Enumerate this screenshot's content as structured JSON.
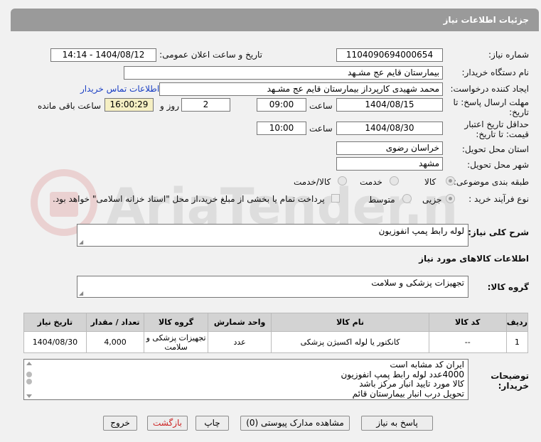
{
  "header": {
    "title": "جزئیات اطلاعات نیاز"
  },
  "form": {
    "need_number_label": "شماره نیاز:",
    "need_number": "1104090694000654",
    "announce_label": "تاریخ و ساعت اعلان عمومی:",
    "announce_value": "1404/08/12 - 14:14",
    "buyer_org_label": "نام دستگاه خریدار:",
    "buyer_org": "بیمارستان قایم  عج  مشـهد",
    "requester_label": "ایجاد کننده درخواست:",
    "requester": "محمد شهیدی کارپرداز بیمارستان قایم  عج  مشـهد",
    "contact_link": "اطلاعات تماس خریدار",
    "deadline_label_1": "مهلت ارسال پاسخ: تا",
    "deadline_label_2": "تاریخ:",
    "deadline_date": "1404/08/15",
    "time_label": "ساعت",
    "deadline_time": "09:00",
    "days_value": "2",
    "days_label": "روز و",
    "remaining_time": "16:00:29",
    "remaining_label": "ساعت باقی مانده",
    "validity_label_1": "حداقل تاریخ اعتبار",
    "validity_label_2": "قیمت: تا تاریخ:",
    "validity_date": "1404/08/30",
    "validity_time": "10:00",
    "province_label": "استان محل تحویل:",
    "province": "خراسان رضوی",
    "city_label": "شهر محل تحویل:",
    "city": "مشهد",
    "category_label": "طبقه بندی موضوعی:",
    "category_options": [
      "کالا",
      "خدمت",
      "کالا/خدمت"
    ],
    "category_selected": "کالا",
    "process_label": "نوع فرآیند خرید :",
    "process_options": [
      "جزیی",
      "متوسط"
    ],
    "payment_note": "پرداخت تمام یا بخشی از مبلغ خرید،از محل \"اسناد خزانه اسلامی\" خواهد بود.",
    "general_desc_label": "شرح کلی نیاز:",
    "general_desc": "لوله رابط پمپ انفوزیون",
    "goods_info_title": "اطلاعات کالاهای مورد نیاز",
    "goods_group_label": "گروه کالا:",
    "goods_group": "تجهیزات پزشکی و سلامت"
  },
  "table": {
    "headers": [
      "ردیف",
      "کد کالا",
      "نام کالا",
      "واحد شمارش",
      "گروه کالا",
      "تعداد / مقدار",
      "تاریخ نیاز"
    ],
    "rows": [
      [
        "1",
        "--",
        "کانکتور یا لوله اکسیژن پزشکی",
        "عدد",
        "تجهیزات پزشکی و سلامت",
        "4,000",
        "1404/08/30"
      ]
    ]
  },
  "buyer_notes_label_1": "توضیحات",
  "buyer_notes_label_2": "خریدار:",
  "buyer_notes": [
    "ایران کد مشابه است",
    "4000عدد  لوله رابط پمپ انفوزیون",
    "کالا مورد تایید انبار مرکز باشد",
    " تحویل درب  انبار بیمارستان قائم"
  ],
  "buttons": {
    "reply": "پاسخ به نیاز",
    "docs": "مشاهده مدارک پیوستی (0)",
    "print": "چاپ",
    "back": "بازگشت",
    "exit": "خروج"
  },
  "colors": {
    "header_bg": "#9a9a9a",
    "link": "#1a3fc4",
    "highlight": "#f5efc3",
    "danger": "#cc2222"
  }
}
